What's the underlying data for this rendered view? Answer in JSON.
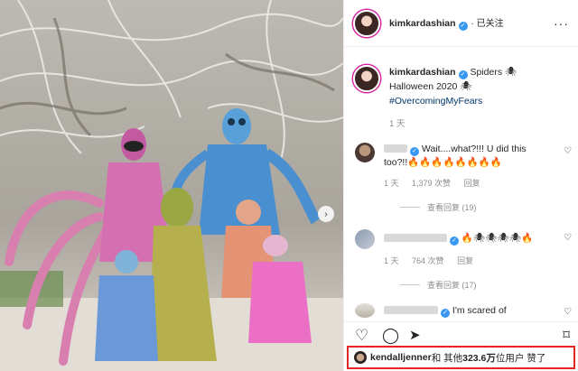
{
  "header": {
    "username": "kimkardashian",
    "follow_label": "· 已关注",
    "more_icon": "more-horizontal-icon"
  },
  "caption": {
    "username": "kimkardashian",
    "text": "Spiders 🕷",
    "line2": "Halloween 2020 🕷",
    "hashtag": "#OvercomingMyFears",
    "age": "1 天"
  },
  "comments": [
    {
      "text": "Wait....what?!!! U did this too?!!🔥🔥🔥🔥🔥🔥🔥🔥",
      "age": "1 天",
      "likes": "1,379 次赞",
      "reply": "回复",
      "view_replies": "查看回复 (19)"
    },
    {
      "text": "🔥🕷🕷🕷🕷🔥",
      "age": "1 天",
      "likes": "764 次赞",
      "reply": "回复",
      "view_replies": "查看回复 (17)"
    },
    {
      "text": "I'm scared of"
    }
  ],
  "likes": {
    "user": "kendalljenner",
    "rest": " 和 其他 ",
    "count": "323.6万",
    "suffix": " 位用户 赞了"
  },
  "colors": {
    "verified": "#3897f0",
    "highlight_border": "#e32626",
    "hashtag": "#00376b"
  }
}
